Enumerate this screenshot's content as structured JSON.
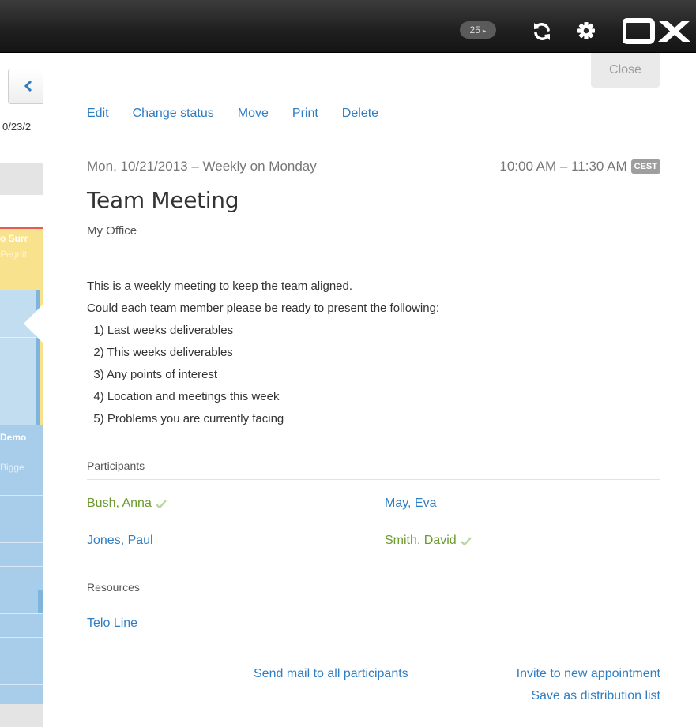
{
  "topbar": {
    "notification_count": "25",
    "refresh_icon": "refresh-icon",
    "settings_icon": "gear-icon",
    "logo_text": "OX"
  },
  "calendar_strip": {
    "date_label": "0/23/2",
    "appointment_1_title": "o Surr",
    "appointment_1_sub": "Pegnit",
    "appointment_2_title": "Demo",
    "appointment_2_sub": "Bigge"
  },
  "detail": {
    "close_label": "Close",
    "actions": [
      "Edit",
      "Change status",
      "Move",
      "Print",
      "Delete"
    ],
    "date_recurrence": "Mon, 10/21/2013 – Weekly on Monday",
    "time_range": "10:00 AM – 11:30 AM",
    "timezone": "CEST",
    "title": "Team Meeting",
    "location": "My Office",
    "description": [
      "This is a weekly meeting to keep the team aligned.",
      "Could each team member please be ready to present the following:",
      "  1) Last weeks deliverables",
      "  2) This weeks deliverables",
      "  3) Any points of interest",
      "  4) Location and meetings this week",
      "  5) Problems you are currently facing"
    ],
    "participants_heading": "Participants",
    "participants": [
      {
        "name": "Bush, Anna",
        "status": "accepted"
      },
      {
        "name": "May, Eva",
        "status": "pending"
      },
      {
        "name": "Jones, Paul",
        "status": "pending"
      },
      {
        "name": "Smith, David",
        "status": "accepted"
      }
    ],
    "resources_heading": "Resources",
    "resources": [
      "Telo Line"
    ],
    "send_mail_label": "Send mail to all participants",
    "invite_label": "Invite to new appointment",
    "distribution_label": "Save as distribution list"
  },
  "colors": {
    "link_blue": "#2f7dc2",
    "accepted_green": "#6c9a2e",
    "topbar_dark": "#1f1f1f"
  }
}
